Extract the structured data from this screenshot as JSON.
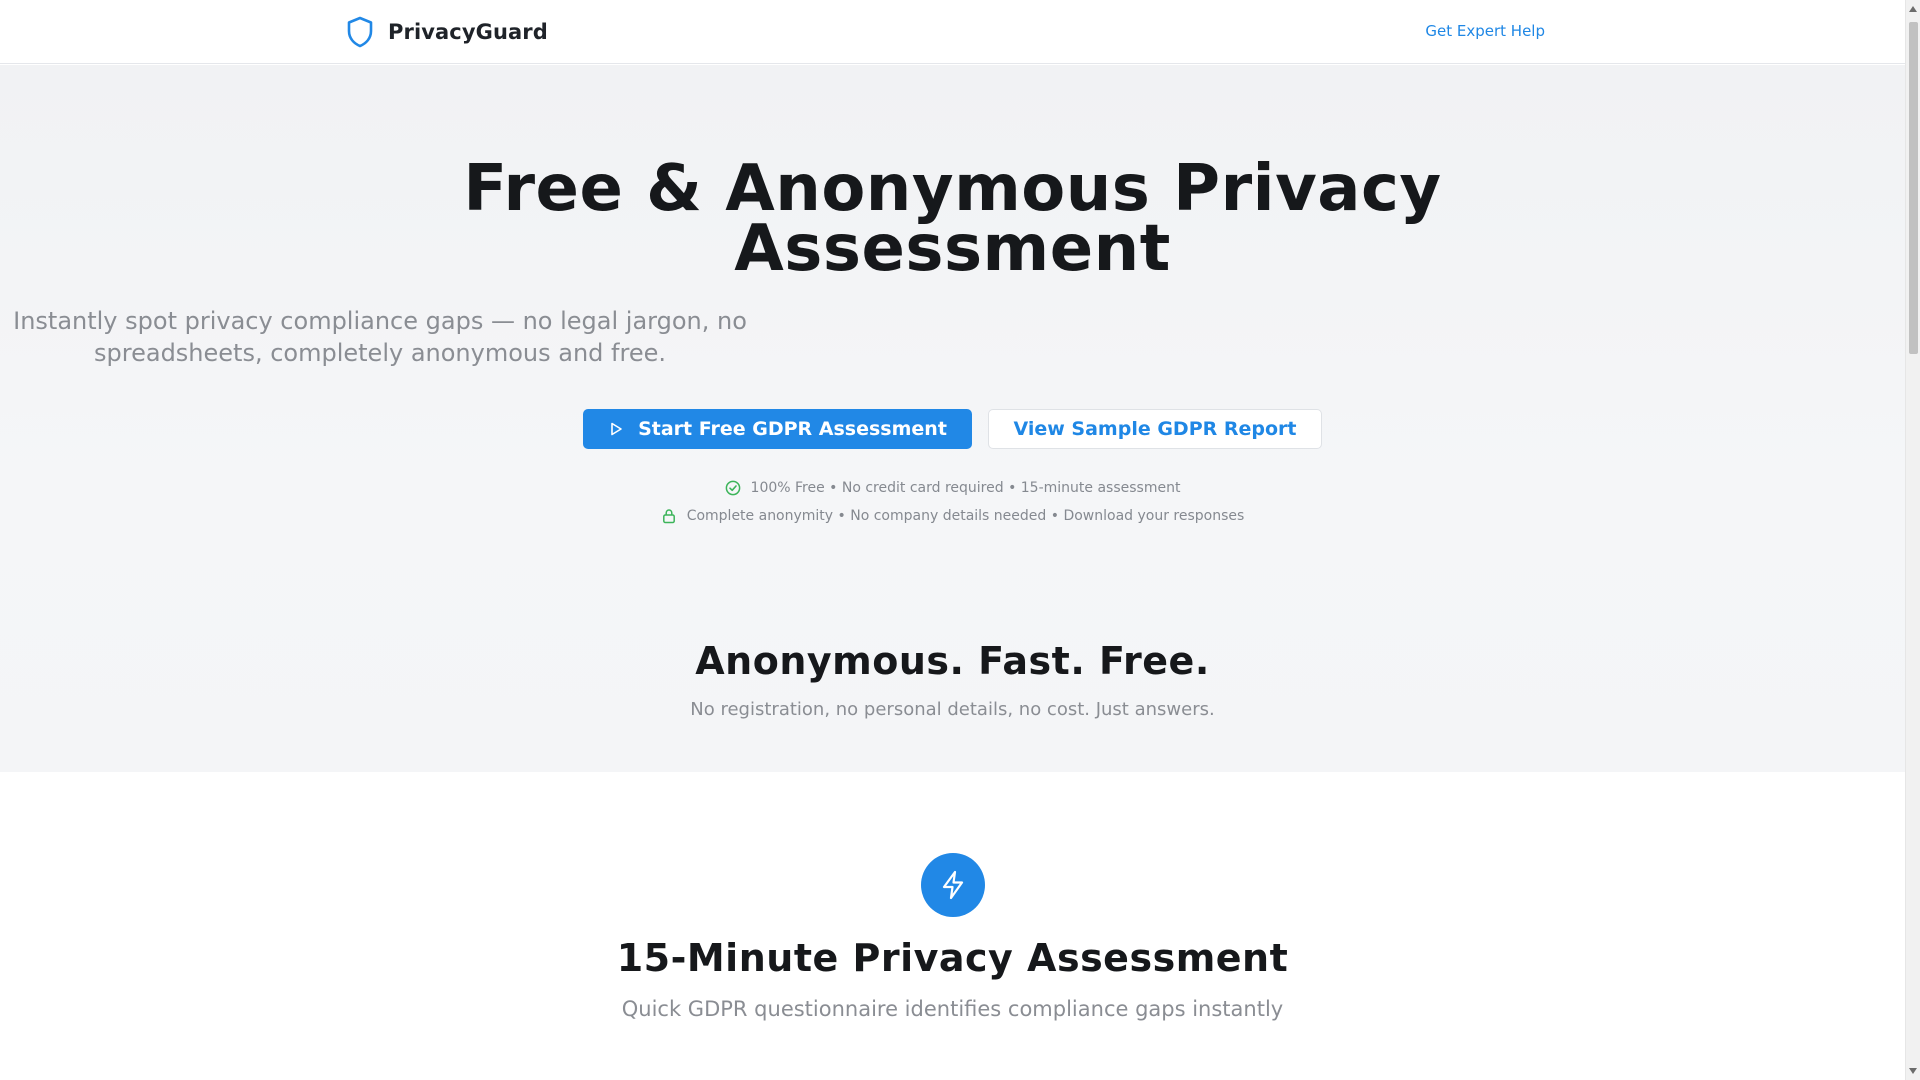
{
  "header": {
    "brand_name": "PrivacyGuard",
    "brand_icon": "shield-icon",
    "expert_link": "Get Expert Help"
  },
  "hero": {
    "title": "Free & Anonymous Privacy Assessment",
    "subtitle": "Instantly spot privacy compliance gaps — no legal jargon, no spreadsheets, completely anonymous and free.",
    "primary_cta": "Start Free GDPR Assessment",
    "primary_cta_icon": "play-icon",
    "secondary_cta": "View Sample GDPR Report",
    "trust_line_1": "100% Free • No credit card required • 15-minute assessment",
    "trust_line_1_icon": "check-circle-icon",
    "trust_line_2": "Complete anonymity • No company details needed • Download your responses",
    "trust_line_2_icon": "lock-icon"
  },
  "section_values": {
    "title": "Anonymous. Fast. Free.",
    "subtitle": "No registration, no personal details, no cost. Just answers."
  },
  "feature": {
    "icon": "lightning-icon",
    "title": "15-Minute Privacy Assessment",
    "subtitle": "Quick GDPR questionnaire identifies compliance gaps instantly"
  },
  "colors": {
    "accent": "#2188e6",
    "link": "#1f87e5",
    "success": "#3cb45a",
    "text_dark": "#16181b",
    "text_muted": "#8a8d93"
  }
}
